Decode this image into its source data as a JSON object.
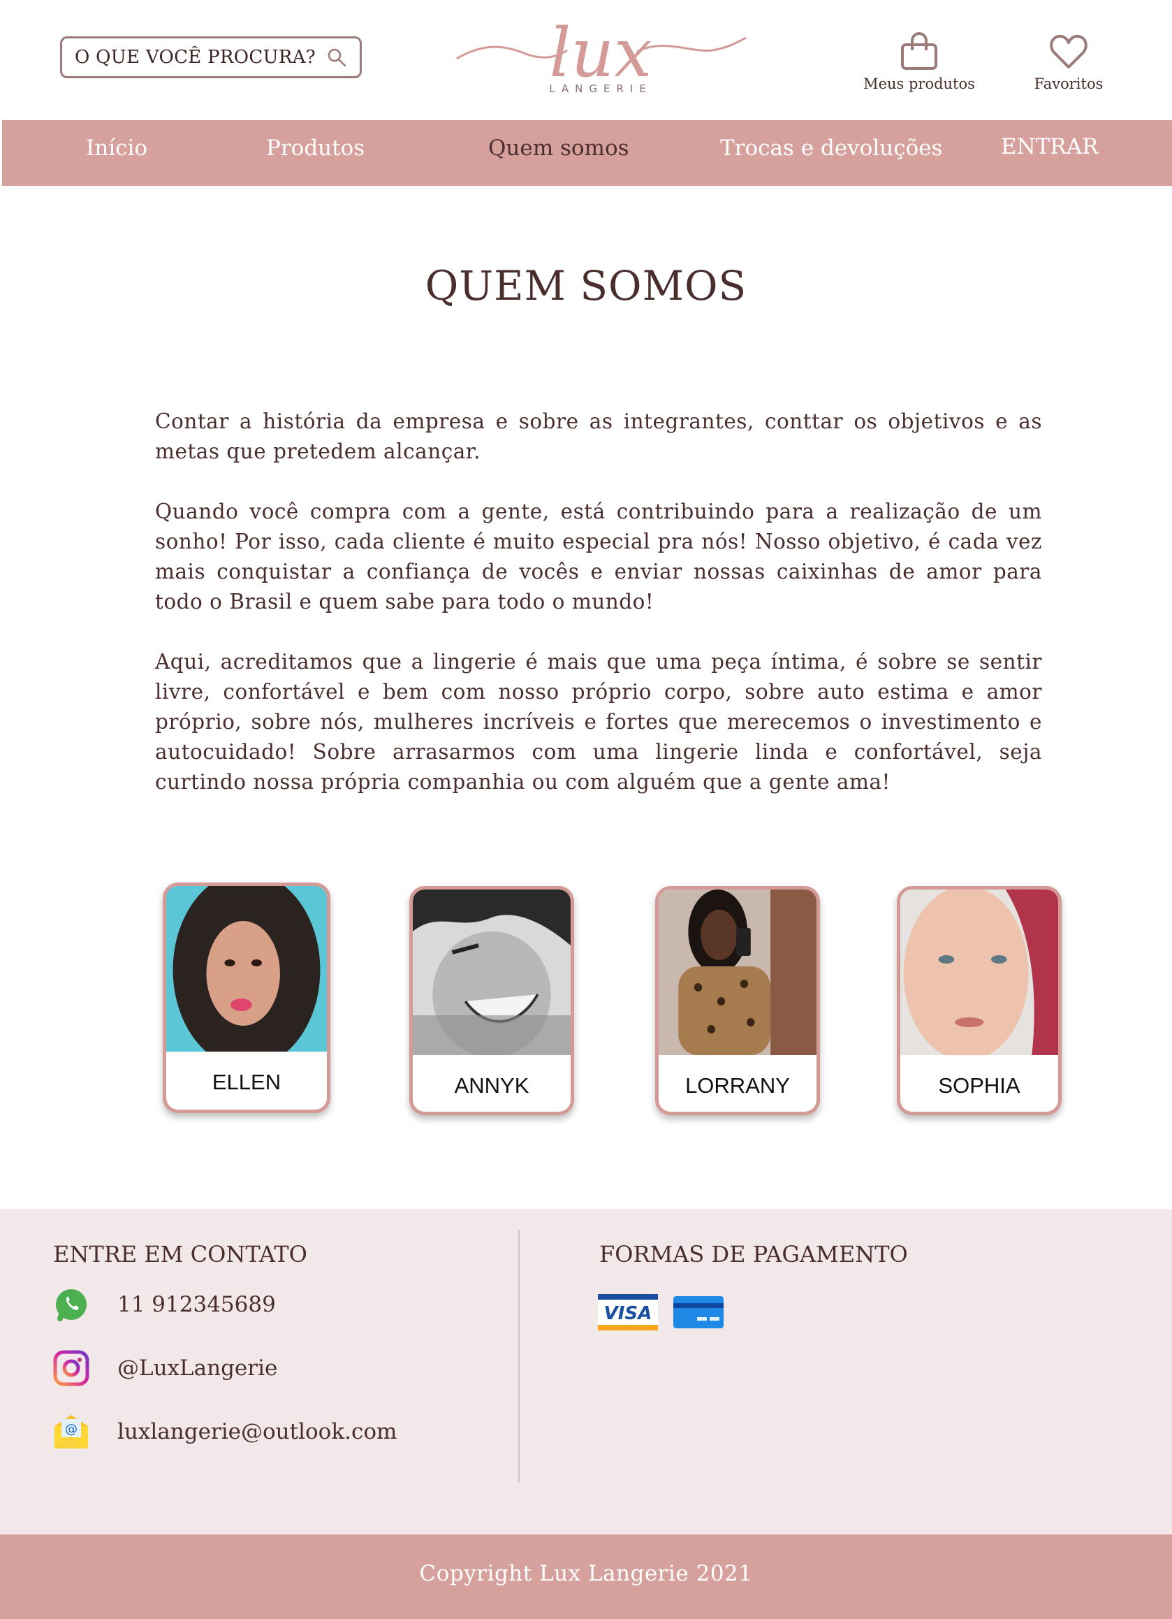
{
  "header": {
    "search_placeholder": "O QUE VOCÊ PROCURA?",
    "logo_text": "lux",
    "logo_subtitle": "LANGERIE",
    "my_products_label": "Meus produtos",
    "favorites_label": "Favoritos"
  },
  "nav": {
    "items": [
      {
        "label": "Início"
      },
      {
        "label": "Produtos"
      },
      {
        "label": "Quem somos",
        "active": true
      },
      {
        "label": "Trocas e devoluções"
      }
    ],
    "login_label": "ENTRAR"
  },
  "main": {
    "title": "QUEM SOMOS",
    "paragraphs": [
      "Contar a história da empresa e sobre as integrantes, conttar os objetivos e as metas que pretedem alcançar.",
      "Quando você compra com a gente, está contribuindo para a realização de um sonho! Por isso, cada cliente é muito especial pra nós! Nosso objetivo, é cada vez mais conquistar a confiança de vocês e enviar nossas caixinhas de amor para todo o Brasil e quem sabe para todo o mundo!",
      "Aqui, acreditamos que a lingerie é mais que uma peça íntima, é sobre se sentir livre, confortável e bem com nosso próprio corpo, sobre auto estima e amor próprio, sobre nós, mulheres incríveis e fortes que merecemos o investimento e autocuidado! Sobre arrasarmos com uma lingerie linda e confortável, seja curtindo nossa própria companhia ou com alguém que a gente ama!"
    ],
    "team": [
      {
        "name": "ELLEN"
      },
      {
        "name": "ANNYK"
      },
      {
        "name": "LORRANY"
      },
      {
        "name": "SOPHIA"
      }
    ]
  },
  "footer": {
    "contact_title": "ENTRE EM CONTATO",
    "phone": "11 912345689",
    "instagram": "@LuxLangerie",
    "email": "luxlangerie@outlook.com",
    "payment_title": "FORMAS DE PAGAMENTO",
    "payment_methods": [
      "VISA",
      "card-icon"
    ],
    "copyright": "Copyright Lux Langerie 2021"
  },
  "colors": {
    "brand": "#d6a19c",
    "text": "#4a2e2e",
    "footer_bg": "#f2e8e9"
  }
}
